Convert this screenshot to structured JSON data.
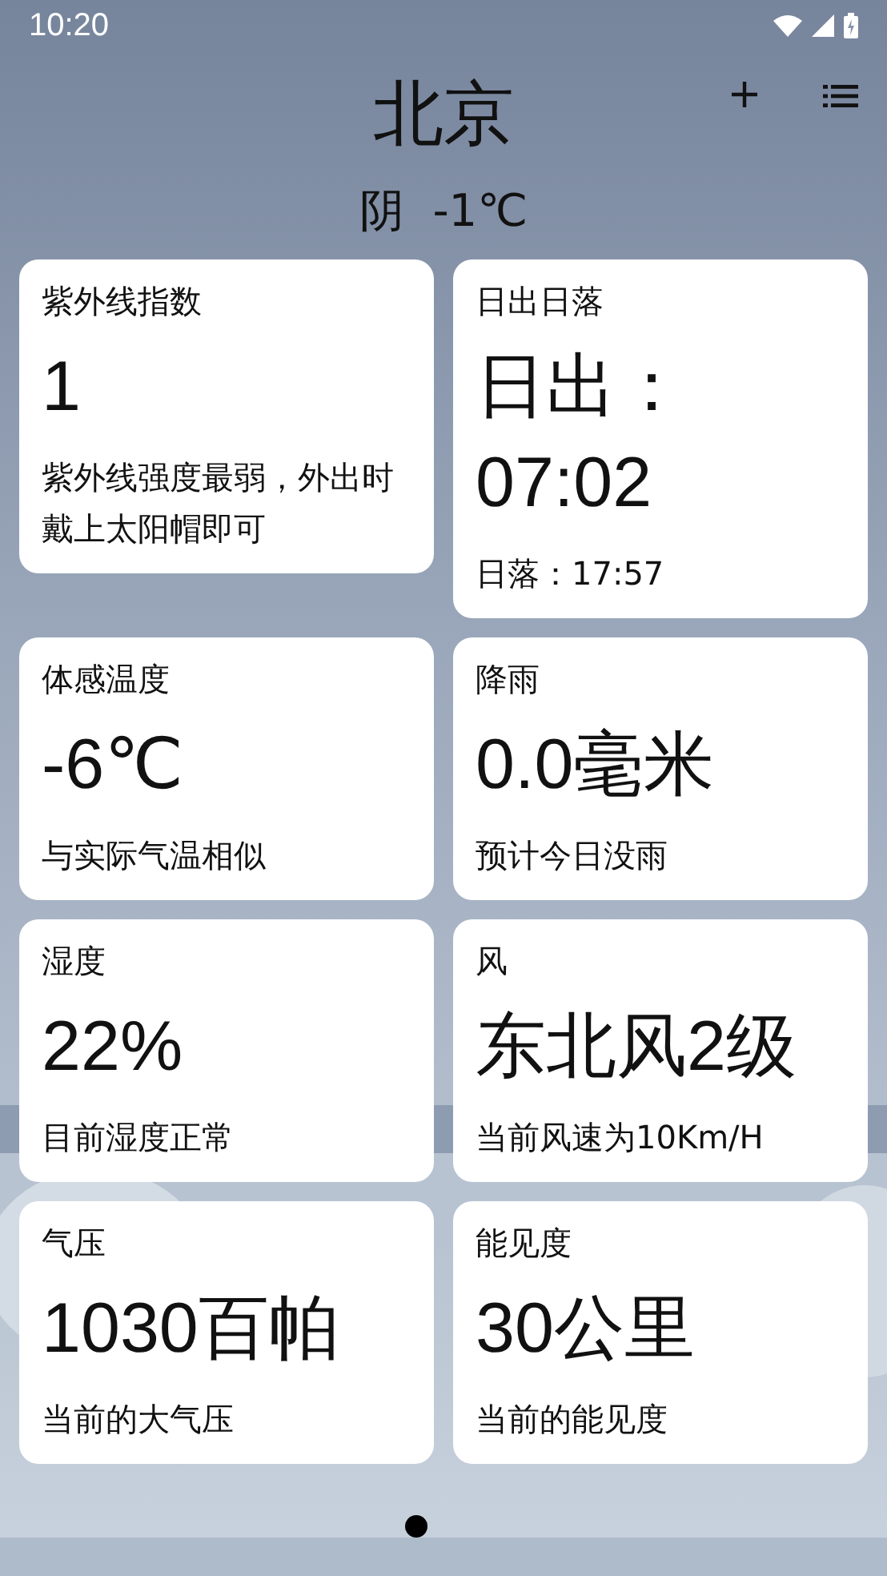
{
  "status_bar": {
    "time": "10:20"
  },
  "header": {
    "city": "北京",
    "weather": "阴  -1℃"
  },
  "cards": [
    {
      "title": "紫外线指数",
      "value": "1",
      "description": "紫外线强度最弱，外出时戴上太阳帽即可"
    },
    {
      "title": "日出日落",
      "value": "日出：07:02",
      "description": "日落：17:57"
    },
    {
      "title": "体感温度",
      "value": "-6℃",
      "description": "与实际气温相似"
    },
    {
      "title": "降雨",
      "value": "0.0毫米",
      "description": "预计今日没雨"
    },
    {
      "title": "湿度",
      "value": "22%",
      "description": "目前湿度正常"
    },
    {
      "title": "风",
      "value": "东北风2级",
      "description": "当前风速为10Km/H"
    },
    {
      "title": "气压",
      "value": "1030百帕",
      "description": "当前的大气压"
    },
    {
      "title": "能见度",
      "value": "30公里",
      "description": "当前的能见度"
    }
  ]
}
